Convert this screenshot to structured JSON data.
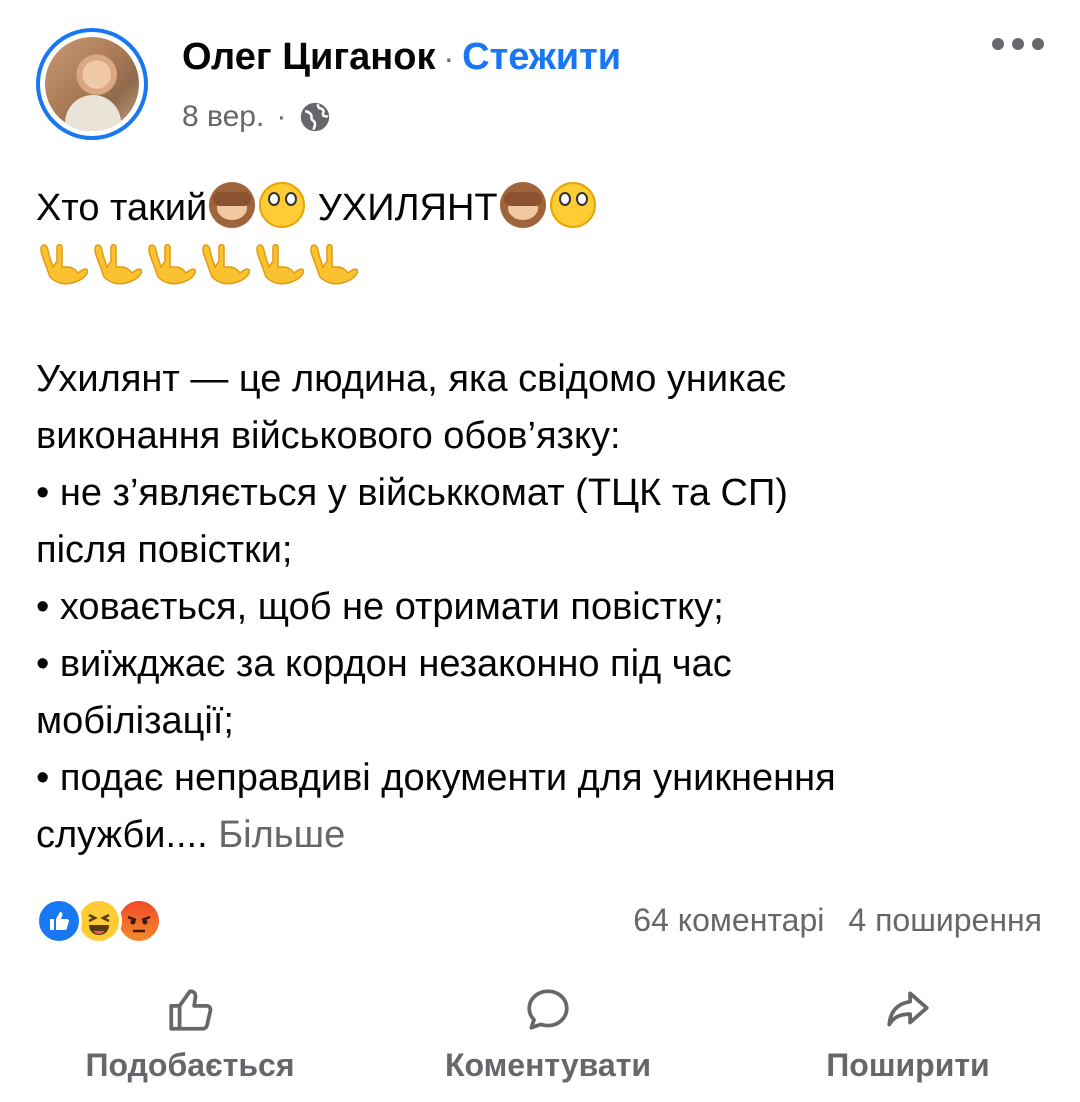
{
  "post": {
    "author": "Олег Циганок",
    "separator": "·",
    "follow_label": "Стежити",
    "date": "8 вер.",
    "meta_separator": "·",
    "privacy_icon": "globe-icon"
  },
  "content": {
    "line1_a": "Хто такий",
    "line1_b": " УХИЛЯНТ",
    "line2_emoji_count": 6,
    "line3": "Ухилянт — це людина, яка свідомо уникає",
    "line4": "виконання військового обов’язку:",
    "line5": " • не з’являється у військкомат (ТЦК та СП)",
    "line6": "після повістки;",
    "line7": " • ховається, щоб не отримати повістку;",
    "line8": " • виїжджає за кордон незаконно під час",
    "line9": "мобілізації;",
    "line10": " • подає неправдиві документи для уникнення",
    "line11": "служби....",
    "see_more": "Більше"
  },
  "reactions": [
    "like",
    "haha",
    "angry"
  ],
  "stats": {
    "comments": "64 коментарі",
    "shares": "4 поширення"
  },
  "actions": {
    "like": "Подобається",
    "comment": "Коментувати",
    "share": "Поширити"
  },
  "colors": {
    "accent": "#1877f2",
    "secondary_text": "#65676b",
    "primary_text": "#050505"
  }
}
